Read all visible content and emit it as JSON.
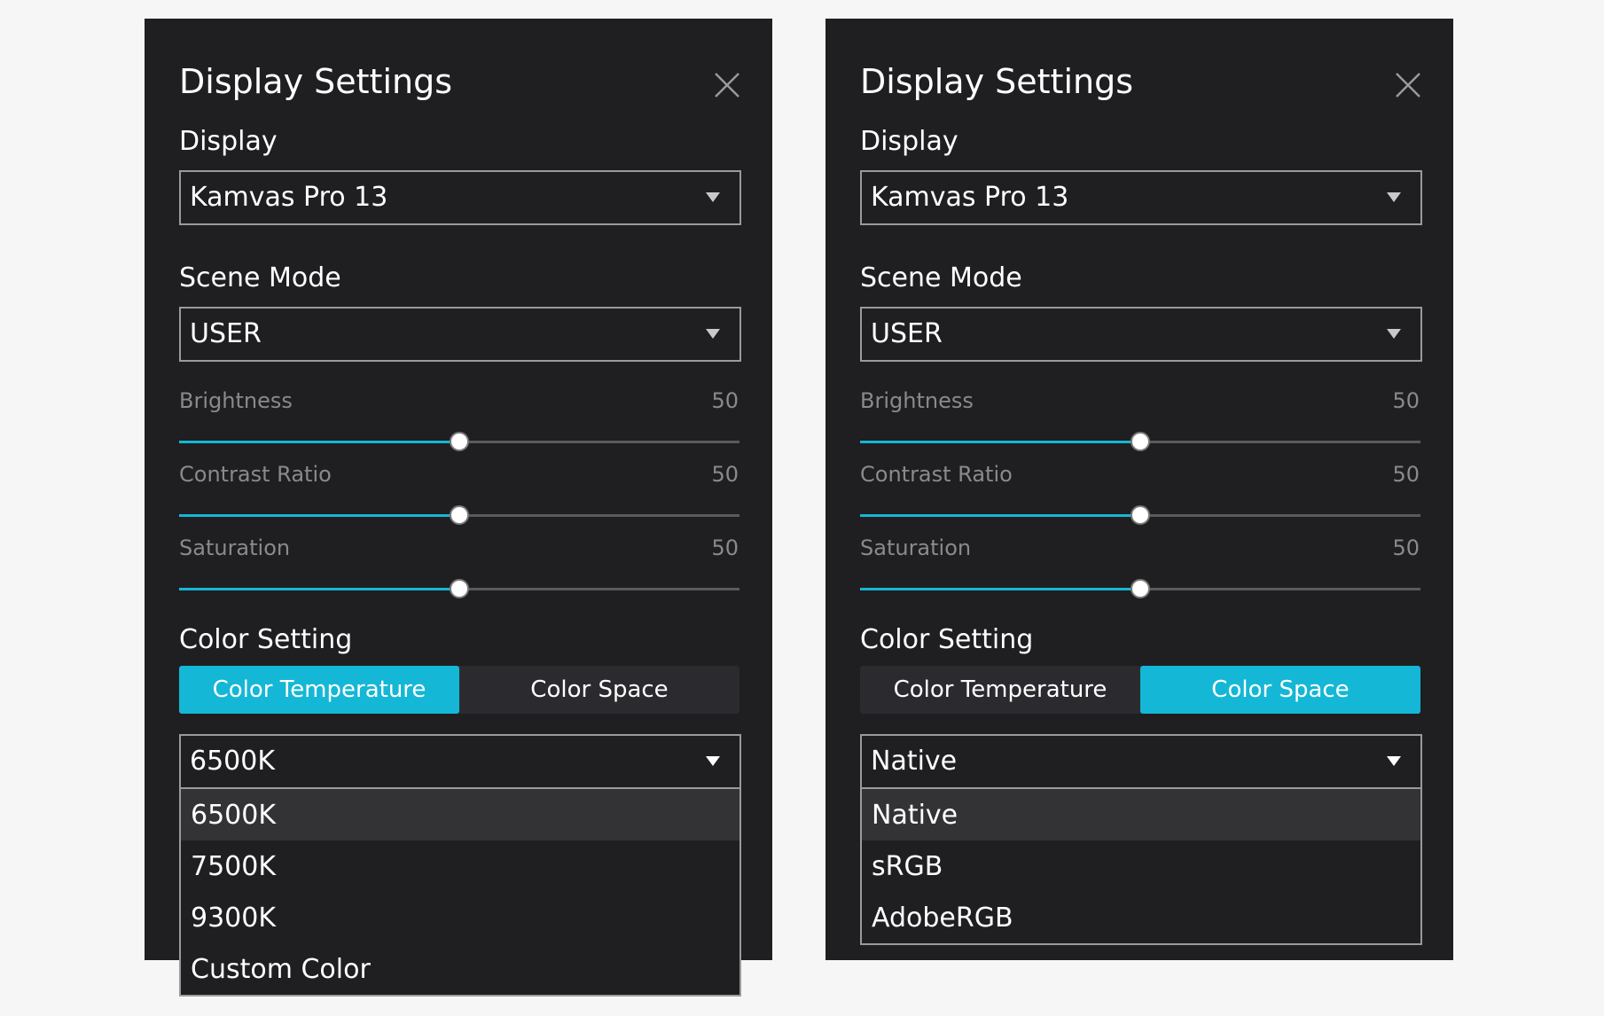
{
  "colors": {
    "panel_bg": "#1f1f22",
    "accent": "#15b7d6",
    "page_bg": "#f6f6f6"
  },
  "panels": [
    {
      "title": "Display Settings",
      "close_icon": "close-icon",
      "display_label": "Display",
      "display_value": "Kamvas Pro 13",
      "scene_mode_label": "Scene Mode",
      "scene_mode_value": "USER",
      "sliders": [
        {
          "label": "Brightness",
          "value": "50",
          "fraction": 0.5
        },
        {
          "label": "Contrast Ratio",
          "value": "50",
          "fraction": 0.5
        },
        {
          "label": "Saturation",
          "value": "50",
          "fraction": 0.5
        }
      ],
      "color_setting_label": "Color Setting",
      "tabs": [
        {
          "label": "Color Temperature",
          "active": true
        },
        {
          "label": "Color Space",
          "active": false
        }
      ],
      "color_select_value": "6500K",
      "options": [
        "6500K",
        "7500K",
        "9300K",
        "Custom Color"
      ],
      "highlighted_option": "6500K"
    },
    {
      "title": "Display Settings",
      "close_icon": "close-icon",
      "display_label": "Display",
      "display_value": "Kamvas Pro 13",
      "scene_mode_label": "Scene Mode",
      "scene_mode_value": "USER",
      "sliders": [
        {
          "label": "Brightness",
          "value": "50",
          "fraction": 0.5
        },
        {
          "label": "Contrast Ratio",
          "value": "50",
          "fraction": 0.5
        },
        {
          "label": "Saturation",
          "value": "50",
          "fraction": 0.5
        }
      ],
      "color_setting_label": "Color Setting",
      "tabs": [
        {
          "label": "Color Temperature",
          "active": false
        },
        {
          "label": "Color Space",
          "active": true
        }
      ],
      "color_select_value": "Native",
      "options": [
        "Native",
        "sRGB",
        "AdobeRGB"
      ],
      "highlighted_option": "Native"
    }
  ]
}
